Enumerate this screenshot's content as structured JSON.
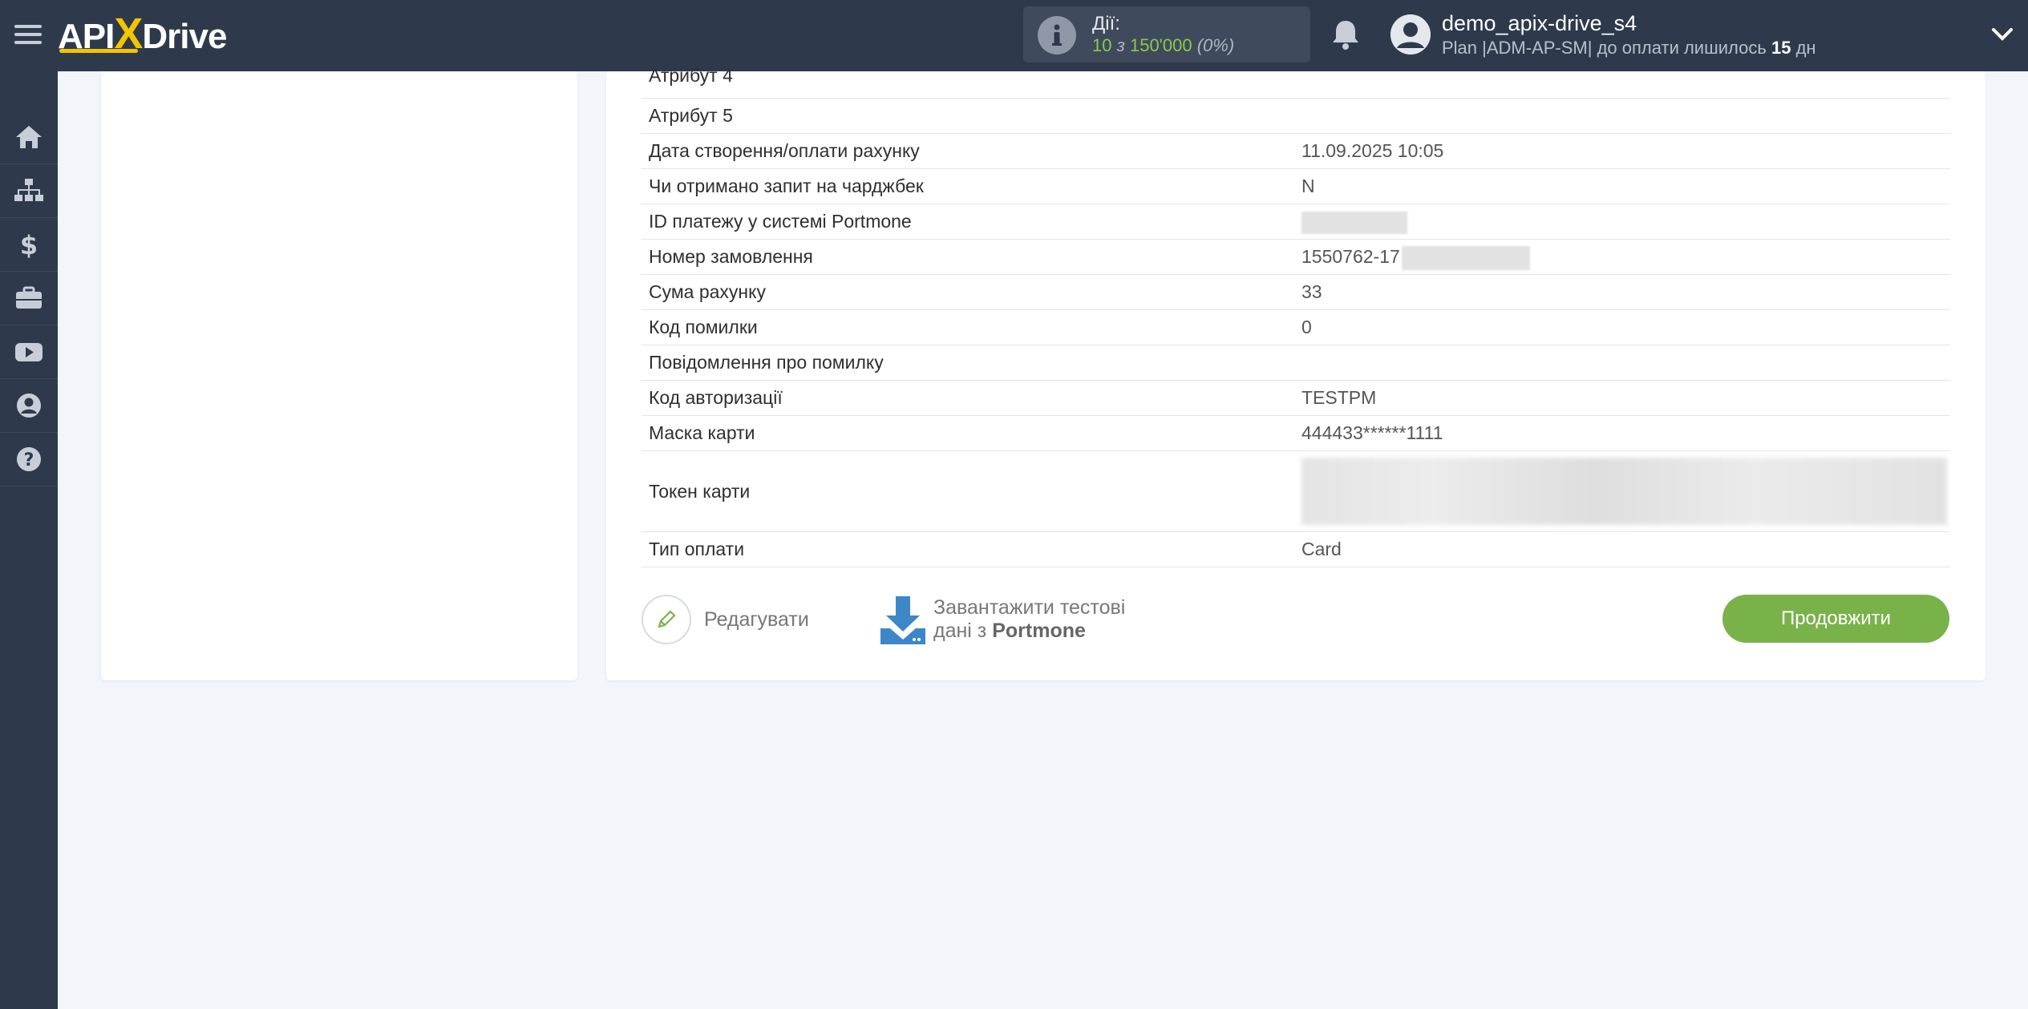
{
  "header": {
    "logo_text_left": "API",
    "logo_text_x": "X",
    "logo_text_right": "Drive",
    "actions_label": "Дії:",
    "actions_used": "10",
    "actions_of": "з",
    "actions_total": "150'000",
    "actions_percent": "(0%)",
    "user_name": "demo_apix-drive_s4",
    "plan_prefix": "Plan |ADM-AP-SM| до оплати лишилось",
    "plan_days": "15",
    "plan_suffix": "дн"
  },
  "sidebar": {
    "items": [
      {
        "icon": "home-icon"
      },
      {
        "icon": "sitemap-icon"
      },
      {
        "icon": "dollar-icon"
      },
      {
        "icon": "briefcase-icon"
      },
      {
        "icon": "youtube-icon"
      },
      {
        "icon": "user-circle-icon"
      },
      {
        "icon": "help-icon"
      }
    ]
  },
  "fields": [
    {
      "key": "Атрибут 4",
      "value": ""
    },
    {
      "key": "Атрибут 5",
      "value": ""
    },
    {
      "key": "Дата створення/оплати рахунку",
      "value": "11.09.2025 10:05"
    },
    {
      "key": "Чи отримано запит на чарджбек",
      "value": "N"
    },
    {
      "key": "ID платежу у системі Portmone",
      "value": ""
    },
    {
      "key": "Номер замовлення",
      "value": "1550762-17"
    },
    {
      "key": "Сума рахунку",
      "value": "33"
    },
    {
      "key": "Код помилки",
      "value": "0"
    },
    {
      "key": "Повідомлення про помилку",
      "value": ""
    },
    {
      "key": "Код авторизації",
      "value": "TESTPM"
    },
    {
      "key": "Маска карти",
      "value": "444433******1111"
    },
    {
      "key": "Токен карти",
      "value": ""
    },
    {
      "key": "Тип оплати",
      "value": "Card"
    }
  ],
  "actions": {
    "edit_label": "Редагувати",
    "download_line1": "Завантажити тестові",
    "download_line2_prefix": "дані з",
    "download_source": "Portmone",
    "continue_label": "Продовжити"
  },
  "colors": {
    "topbar": "#2e3a4c",
    "accent_green": "#7ab24a",
    "logo_yellow": "#f5c400",
    "download_blue": "#3d87c8"
  }
}
